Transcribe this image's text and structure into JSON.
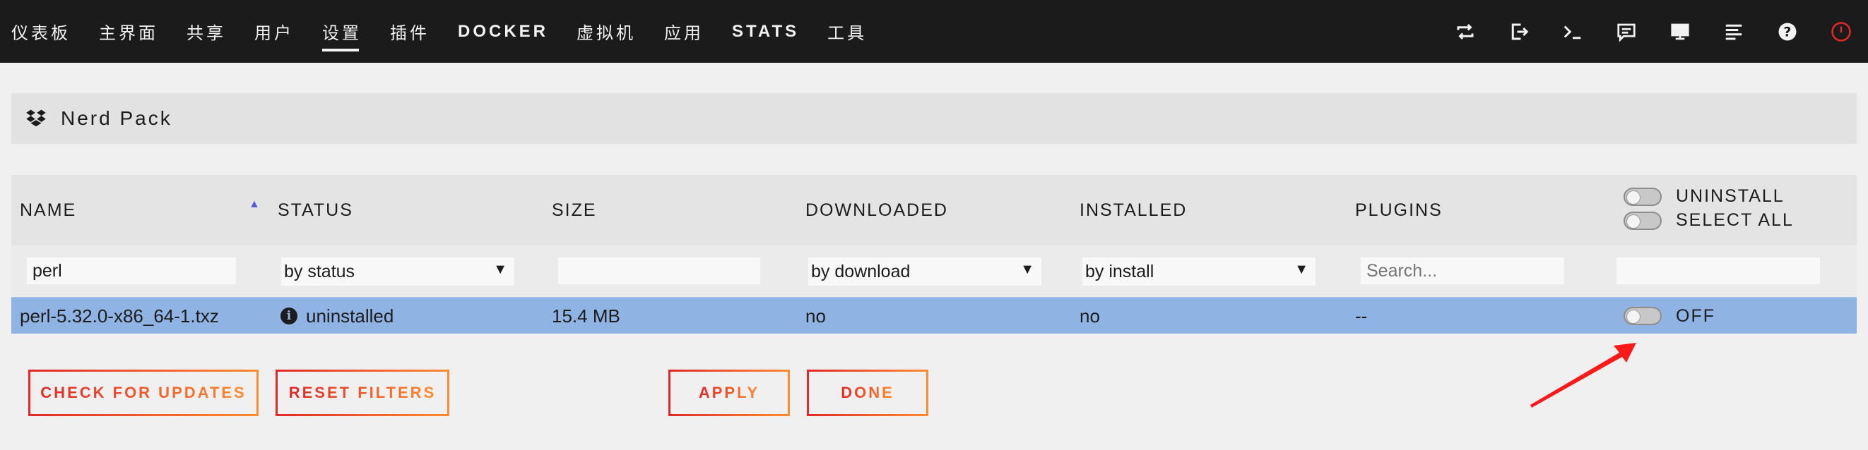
{
  "nav": {
    "items": [
      {
        "label": "仪表板",
        "active": false
      },
      {
        "label": "主界面",
        "active": false
      },
      {
        "label": "共享",
        "active": false
      },
      {
        "label": "用户",
        "active": false
      },
      {
        "label": "设置",
        "active": true
      },
      {
        "label": "插件",
        "active": false
      },
      {
        "label": "DOCKER",
        "active": false
      },
      {
        "label": "虚拟机",
        "active": false
      },
      {
        "label": "应用",
        "active": false
      },
      {
        "label": "STATS",
        "active": false
      },
      {
        "label": "工具",
        "active": false
      }
    ],
    "icons": [
      "refresh-icon",
      "logout-icon",
      "terminal-icon",
      "feedback-icon",
      "monitor-icon",
      "log-icon",
      "help-icon",
      "power-icon"
    ]
  },
  "title": "Nerd Pack",
  "table": {
    "headers": {
      "name": "NAME",
      "status": "STATUS",
      "size": "SIZE",
      "downloaded": "DOWNLOADED",
      "installed": "INSTALLED",
      "plugins": "PLUGINS",
      "uninstall": "UNINSTALL",
      "select_all": "SELECT ALL"
    },
    "filters": {
      "name_value": "perl",
      "status_selected": "by status",
      "download_selected": "by download",
      "install_selected": "by install",
      "plugins_placeholder": "Search..."
    },
    "rows": [
      {
        "name": "perl-5.32.0-x86_64-1.txz",
        "status": "uninstalled",
        "size": "15.4 MB",
        "downloaded": "no",
        "installed": "no",
        "plugins": "--",
        "toggle_label": "OFF"
      }
    ]
  },
  "buttons": {
    "check_updates": "CHECK FOR UPDATES",
    "reset_filters": "RESET FILTERS",
    "apply": "APPLY",
    "done": "DONE"
  },
  "colors": {
    "topbar": "#1c1b1b",
    "row_highlight": "#8fb3e3",
    "button_gradient_start": "#e22828",
    "button_gradient_end": "#ff8c2f",
    "annotation_arrow": "#ff1a1a"
  }
}
